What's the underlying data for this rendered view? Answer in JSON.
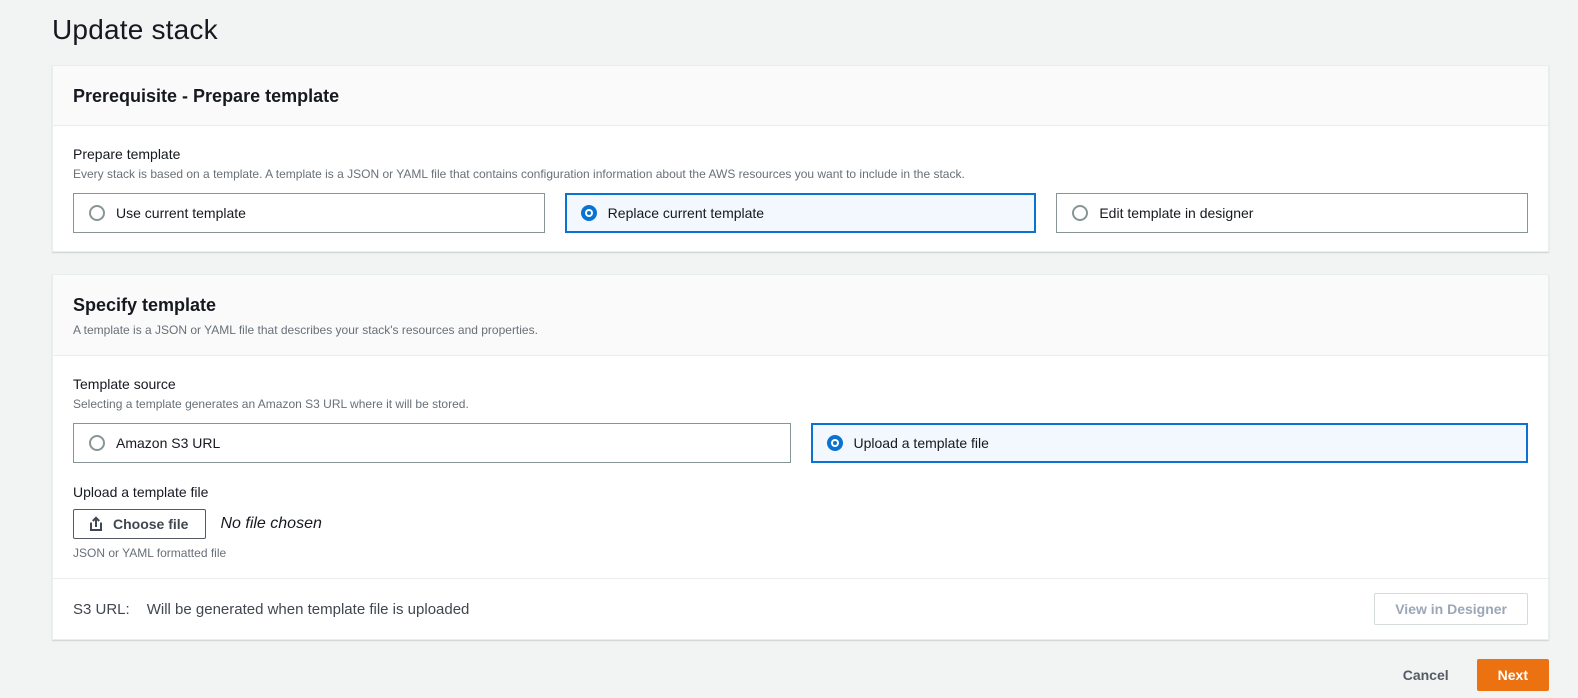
{
  "page": {
    "title": "Update stack"
  },
  "prerequisite_card": {
    "title": "Prerequisite - Prepare template",
    "field_label": "Prepare template",
    "field_description": "Every stack is based on a template. A template is a JSON or YAML file that contains configuration information about the AWS resources you want to include in the stack.",
    "options": [
      {
        "label": "Use current template",
        "selected": false
      },
      {
        "label": "Replace current template",
        "selected": true
      },
      {
        "label": "Edit template in designer",
        "selected": false
      }
    ]
  },
  "specify_card": {
    "title": "Specify template",
    "description": "A template is a JSON or YAML file that describes your stack's resources and properties.",
    "template_source": {
      "label": "Template source",
      "description": "Selecting a template generates an Amazon S3 URL where it will be stored.",
      "options": [
        {
          "label": "Amazon S3 URL",
          "selected": false
        },
        {
          "label": "Upload a template file",
          "selected": true
        }
      ]
    },
    "upload": {
      "label": "Upload a template file",
      "choose_file_label": "Choose file",
      "file_status": "No file chosen",
      "hint": "JSON or YAML formatted file"
    },
    "footer": {
      "s3_label": "S3 URL:",
      "s3_value": "Will be generated when template file is uploaded",
      "view_designer_label": "View in Designer"
    }
  },
  "actions": {
    "cancel_label": "Cancel",
    "next_label": "Next"
  },
  "colors": {
    "accent_orange": "#ec7211",
    "accent_blue": "#0972d3",
    "selected_tile_bg": "#f2f8fd",
    "page_bg": "#f2f3f3"
  }
}
